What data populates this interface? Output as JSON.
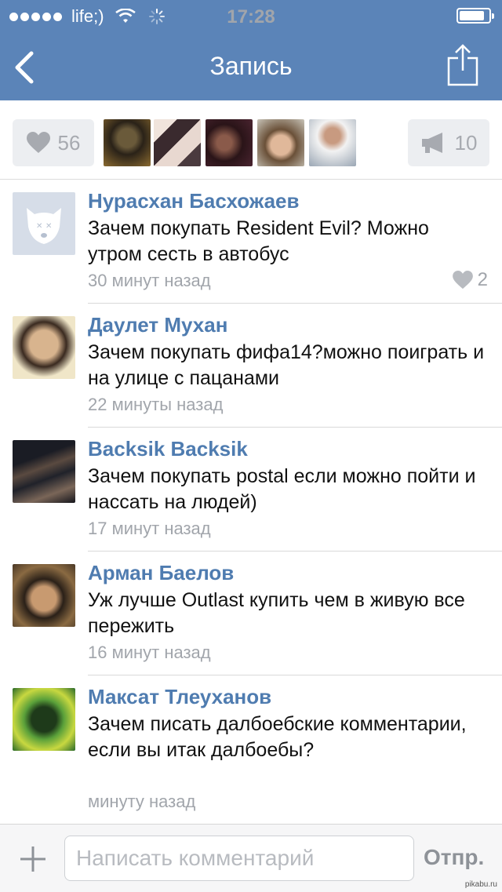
{
  "status_bar": {
    "carrier": "life;)",
    "time": "17:28",
    "battery_level": 0.85
  },
  "nav": {
    "title": "Запись",
    "back_icon": "chevron-left-icon",
    "share_icon": "share-icon"
  },
  "likes": {
    "count": "56",
    "reposts": "10"
  },
  "comments": [
    {
      "author": "Нурасхан Басхожаев",
      "text": "Зачем покупать Resident Evil? Можно утром сесть в автобус",
      "time": "30 минут назад",
      "likes": "2"
    },
    {
      "author": "Даулет Мухан",
      "text": "Зачем покупать фифа14?можно поиграть и на улице с пацанами",
      "time": "22 минуты назад"
    },
    {
      "author": "Backsik Backsik",
      "text": "Зачем покупать postal если можно пойти и нассать на людей)",
      "time": "17 минут назад"
    },
    {
      "author": "Арман Баелов",
      "text": "Уж лучше Outlast купить чем в живую все пережить",
      "time": "16 минут назад"
    },
    {
      "author": "Максат Тлеуханов",
      "text": "Зачем писать далбоебские комментарии, если вы итак далбоебы?",
      "time": "минуту назад"
    }
  ],
  "composer": {
    "placeholder": "Написать комментарий",
    "send_label": "Отпр."
  },
  "watermark": "pikabu.ru",
  "colors": {
    "header": "#5b84b8",
    "author": "#4f7cb0",
    "muted": "#a1a5ab"
  }
}
